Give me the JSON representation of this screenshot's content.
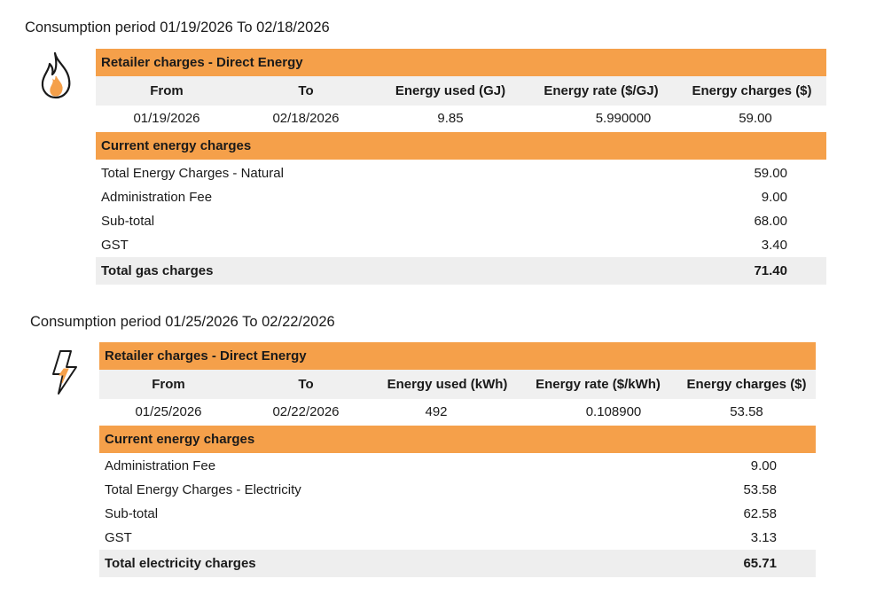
{
  "gas": {
    "period_title": "Consumption period 01/19/2026 To 02/18/2026",
    "retailer_label": "Retailer charges - Direct Energy",
    "columns": [
      "From",
      "To",
      "Energy used (GJ)",
      "Energy rate ($/GJ)",
      "Energy charges ($)"
    ],
    "row": [
      "01/19/2026",
      "02/18/2026",
      "9.85",
      "5.990000",
      "59.00"
    ],
    "current_label": "Current energy charges",
    "lines": [
      {
        "label": "Total Energy Charges - Natural",
        "amount": "59.00"
      },
      {
        "label": "Administration Fee",
        "amount": "9.00"
      },
      {
        "label": "Sub-total",
        "amount": "68.00"
      },
      {
        "label": "GST",
        "amount": "3.40"
      }
    ],
    "total": {
      "label": "Total gas charges",
      "amount": "71.40"
    },
    "icon": "flame-icon"
  },
  "electricity": {
    "period_title": "Consumption period 01/25/2026 To 02/22/2026",
    "retailer_label": "Retailer charges - Direct Energy",
    "columns": [
      "From",
      "To",
      "Energy used (kWh)",
      "Energy rate ($/kWh)",
      "Energy charges ($)"
    ],
    "row": [
      "01/25/2026",
      "02/22/2026",
      "492",
      "0.108900",
      "53.58"
    ],
    "current_label": "Current energy charges",
    "lines": [
      {
        "label": "Administration Fee",
        "amount": "9.00"
      },
      {
        "label": "Total Energy Charges - Electricity",
        "amount": "53.58"
      },
      {
        "label": "Sub-total",
        "amount": "62.58"
      },
      {
        "label": "GST",
        "amount": "3.13"
      }
    ],
    "total": {
      "label": "Total electricity charges",
      "amount": "65.71"
    },
    "icon": "lightning-icon"
  },
  "colors": {
    "accent": "#f5a04a",
    "header_bg": "#f0f0f0",
    "total_bg": "#eeeeee"
  }
}
